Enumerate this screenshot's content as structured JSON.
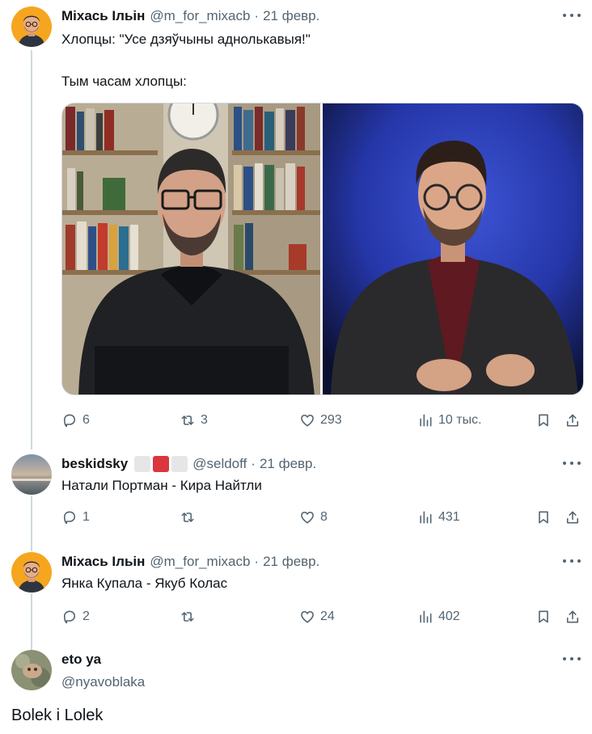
{
  "tweets": [
    {
      "name": "Міхась Ільін",
      "handle": "@m_for_mixacb",
      "date": "21 февр.",
      "lines": [
        "Хлопцы: \"Усе дзяўчыны аднолькавыя!\"",
        "Тым часам хлопцы:"
      ],
      "stats": {
        "replies": "6",
        "retweets": "3",
        "likes": "293",
        "views": "10 тыс."
      }
    },
    {
      "name": "beskidsky",
      "handle": "@seldoff",
      "date": "21 февр.",
      "lines": [
        "Натали Портман - Кира Найтли"
      ],
      "stats": {
        "replies": "1",
        "retweets": "",
        "likes": "8",
        "views": "431"
      }
    },
    {
      "name": "Міхась Ільін",
      "handle": "@m_for_mixacb",
      "date": "21 февр.",
      "lines": [
        "Янка Купала - Якуб Колас"
      ],
      "stats": {
        "replies": "2",
        "retweets": "",
        "likes": "24",
        "views": "402"
      }
    },
    {
      "name": "eto ya",
      "handle": "@nyavoblaka",
      "text": "Bolek i Lolek"
    }
  ],
  "icons": {
    "reply": "reply-icon",
    "retweet": "retweet-icon",
    "like": "like-icon",
    "views": "views-icon",
    "bookmark": "bookmark-icon",
    "share": "share-icon",
    "more": "more-icon"
  },
  "colors": {
    "text": "#0f1419",
    "secondary": "#536471",
    "thread_line": "#cfd9de",
    "flag_white": "#e6e6e6",
    "flag_red": "#d9363e"
  }
}
